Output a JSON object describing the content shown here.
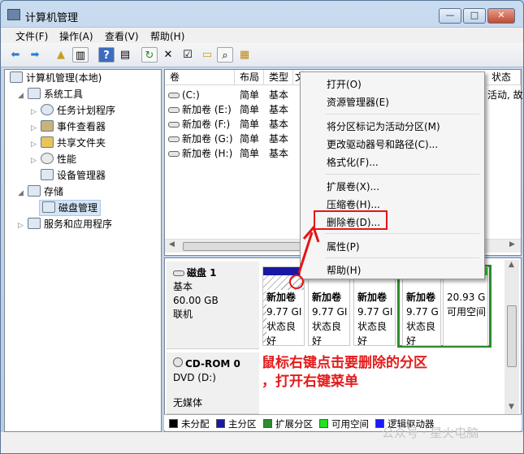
{
  "window": {
    "title": "计算机管理",
    "min": "—",
    "max": "□",
    "close": "✕"
  },
  "menu": [
    "文件(F)",
    "操作(A)",
    "查看(V)",
    "帮助(H)"
  ],
  "toolbar": {
    "icons": [
      "back-icon",
      "forward-icon",
      "up-folder-icon",
      "show-tree-icon",
      "help-icon",
      "view-icon",
      "refresh-icon",
      "delete-icon",
      "properties-icon",
      "open-folder-icon",
      "search-icon",
      "export-icon"
    ]
  },
  "tree": [
    {
      "label": "计算机管理(本地)",
      "arrow": ""
    },
    {
      "label": "系统工具",
      "arrow": "◢"
    },
    {
      "label": "任务计划程序",
      "arrow": "▷"
    },
    {
      "label": "事件查看器",
      "arrow": "▷"
    },
    {
      "label": "共享文件夹",
      "arrow": "▷"
    },
    {
      "label": "性能",
      "arrow": "▷"
    },
    {
      "label": "设备管理器",
      "arrow": ""
    },
    {
      "label": "存储",
      "arrow": "◢"
    },
    {
      "label": "磁盘管理",
      "arrow": ""
    },
    {
      "label": "服务和应用程序",
      "arrow": "▷"
    }
  ],
  "volumes": {
    "headers": [
      "卷",
      "布局",
      "类型",
      "文",
      "状态"
    ],
    "rows": [
      {
        "name": "(C:)",
        "layout": "简单",
        "type": "基本"
      },
      {
        "name": "新加卷 (E:)",
        "layout": "简单",
        "type": "基本"
      },
      {
        "name": "新加卷 (F:)",
        "layout": "简单",
        "type": "基本"
      },
      {
        "name": "新加卷 (G:)",
        "layout": "简单",
        "type": "基本"
      },
      {
        "name": "新加卷 (H:)",
        "layout": "简单",
        "type": "基本"
      }
    ],
    "status_right": "活动, 故"
  },
  "disk1": {
    "name": "磁盘 1",
    "kind": "基本",
    "size": "60.00 GB",
    "state": "联机",
    "partitions": [
      {
        "name": "新加卷",
        "size": "9.77 GI",
        "status": "状态良好"
      },
      {
        "name": "新加卷",
        "size": "9.77 GI",
        "status": "状态良好"
      },
      {
        "name": "新加卷",
        "size": "9.77 GI",
        "status": "状态良好"
      },
      {
        "name": "新加卷",
        "size": "9.77 G",
        "status": "状态良好"
      },
      {
        "name": "",
        "size": "20.93 G",
        "status": "可用空间"
      }
    ]
  },
  "cdrom": {
    "name": "CD-ROM 0",
    "drive": "DVD (D:)",
    "media": "无媒体"
  },
  "legend": [
    {
      "label": "未分配",
      "color": "#000000"
    },
    {
      "label": "主分区",
      "color": "#1818a4"
    },
    {
      "label": "扩展分区",
      "color": "#2e8b2e"
    },
    {
      "label": "可用空间",
      "color": "#22e022"
    },
    {
      "label": "逻辑驱动器",
      "color": "#1a1aff"
    }
  ],
  "context_menu": [
    "打开(O)",
    "资源管理器(E)",
    "将分区标记为活动分区(M)",
    "更改驱动器号和路径(C)...",
    "格式化(F)...",
    "扩展卷(X)...",
    "压缩卷(H)...",
    "删除卷(D)...",
    "属性(P)",
    "帮助(H)"
  ],
  "annotation": {
    "line1": "鼠标右键点击要删除的分区",
    "line2": "，打开右键菜单",
    "color": "#e41b1b"
  },
  "watermark": "公众号 · 星火电脑"
}
